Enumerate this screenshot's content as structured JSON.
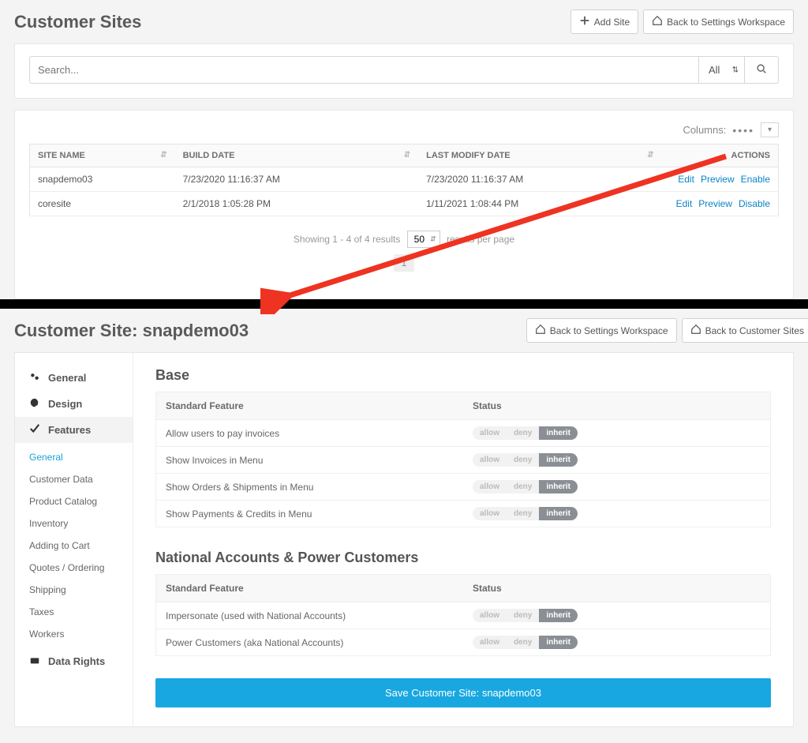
{
  "top": {
    "title": "Customer Sites",
    "add_site": "Add Site",
    "back_workspace": "Back to Settings Workspace",
    "search_placeholder": "Search...",
    "search_select": "All",
    "columns_label": "Columns:",
    "headers": {
      "site_name": "SITE NAME",
      "build_date": "BUILD DATE",
      "last_modify": "LAST MODIFY DATE",
      "actions": "ACTIONS"
    },
    "rows": [
      {
        "name": "snapdemo03",
        "build": "7/23/2020 11:16:37 AM",
        "modify": "7/23/2020 11:16:37 AM",
        "actions": [
          "Edit",
          "Preview",
          "Enable"
        ]
      },
      {
        "name": "coresite",
        "build": "2/1/2018 1:05:28 PM",
        "modify": "1/11/2021 1:08:44 PM",
        "actions": [
          "Edit",
          "Preview",
          "Disable"
        ]
      }
    ],
    "pager": {
      "showing_pre": "Showing 1 - 4 of 4 results",
      "rpp": "50",
      "showing_post": "results per page",
      "page": "1"
    }
  },
  "bottom": {
    "title": "Customer Site: snapdemo03",
    "back_workspace": "Back to Settings Workspace",
    "back_sites": "Back to Customer Sites",
    "sidebar_top": [
      {
        "icon": "gears-icon",
        "label": "General"
      },
      {
        "icon": "palette-icon",
        "label": "Design"
      },
      {
        "icon": "check-icon",
        "label": "Features"
      }
    ],
    "sidebar_sub": [
      "General",
      "Customer Data",
      "Product Catalog",
      "Inventory",
      "Adding to Cart",
      "Quotes / Ordering",
      "Shipping",
      "Taxes",
      "Workers"
    ],
    "sidebar_bottom": {
      "icon": "disk-icon",
      "label": "Data Rights"
    },
    "feature_headers": {
      "feature": "Standard Feature",
      "status": "Status"
    },
    "toggle": {
      "allow": "allow",
      "deny": "deny",
      "inherit": "inherit"
    },
    "sections": [
      {
        "title": "Base",
        "rows": [
          "Allow users to pay invoices",
          "Show Invoices in Menu",
          "Show Orders & Shipments in Menu",
          "Show Payments & Credits in Menu"
        ]
      },
      {
        "title": "National Accounts & Power Customers",
        "rows": [
          "Impersonate (used with National Accounts)",
          "Power Customers (aka National Accounts)"
        ]
      }
    ],
    "save": "Save Customer Site: snapdemo03"
  }
}
